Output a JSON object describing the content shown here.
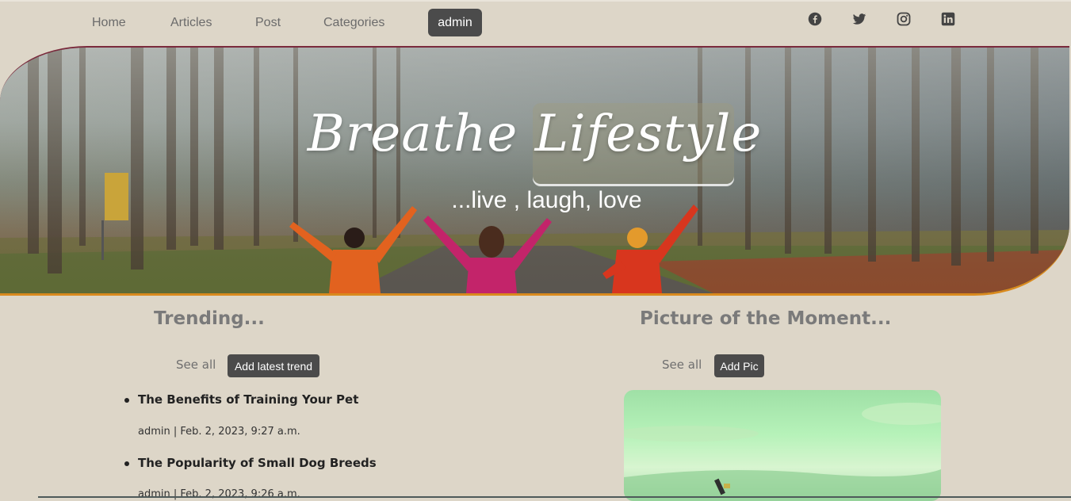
{
  "nav": {
    "links": [
      "Home",
      "Articles",
      "Post",
      "Categories"
    ],
    "user": "admin",
    "social": [
      "facebook-icon",
      "twitter-icon",
      "instagram-icon",
      "linkedin-icon"
    ]
  },
  "hero": {
    "title": "Breathe Lifestyle",
    "subtitle": "...live , laugh, love"
  },
  "trending": {
    "title": "Trending...",
    "see_all": "See all",
    "add_button": "Add latest trend",
    "items": [
      {
        "title": "The Benefits of Training Your Pet",
        "meta": "admin | Feb. 2, 2023, 9:27 a.m."
      },
      {
        "title": "The Popularity of Small Dog Breeds",
        "meta": "admin | Feb. 2, 2023, 9:26 a.m."
      }
    ]
  },
  "picture": {
    "title": "Picture of the Moment...",
    "see_all": "See all",
    "add_button": "Add Pic"
  },
  "colors": {
    "background": "#ddd6c8",
    "button": "#4b4b4b",
    "hero_top_border": "#7a2a3c",
    "hero_bottom_border": "#d98a1e"
  }
}
